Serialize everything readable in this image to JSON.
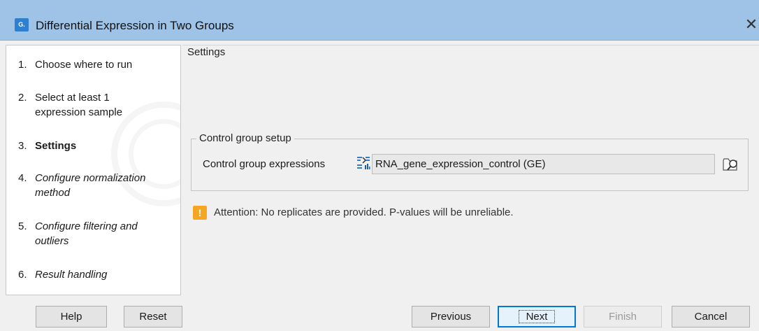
{
  "window": {
    "title": "Differential Expression in Two Groups",
    "app_icon_text": "G.",
    "close_glyph": "✕"
  },
  "wizard": {
    "steps": [
      {
        "num": "1.",
        "label": "Choose where to run",
        "state": "done"
      },
      {
        "num": "2.",
        "label": "Select at least 1 expression sample",
        "state": "done"
      },
      {
        "num": "3.",
        "label": "Settings",
        "state": "current"
      },
      {
        "num": "4.",
        "label": "Configure normalization method",
        "state": "future"
      },
      {
        "num": "5.",
        "label": "Configure filtering and outliers",
        "state": "future"
      },
      {
        "num": "6.",
        "label": "Result handling",
        "state": "future"
      }
    ]
  },
  "settings": {
    "title": "Settings",
    "group_title": "Control group setup",
    "field_label": "Control group expressions",
    "field_value": "RNA_gene_expression_control (GE)",
    "field_icon": "expression-track-icon",
    "browse_icon": "folder-search-icon",
    "warning_icon_text": "!",
    "warning_text": "Attention: No replicates are provided. P-values will be unreliable."
  },
  "buttons": {
    "help": "Help",
    "reset": "Reset",
    "previous": "Previous",
    "next": "Next",
    "finish": "Finish",
    "cancel": "Cancel"
  },
  "colors": {
    "titlebar": "#9fc3e6",
    "warning": "#f5a623",
    "default_button_border": "#0078d7"
  }
}
